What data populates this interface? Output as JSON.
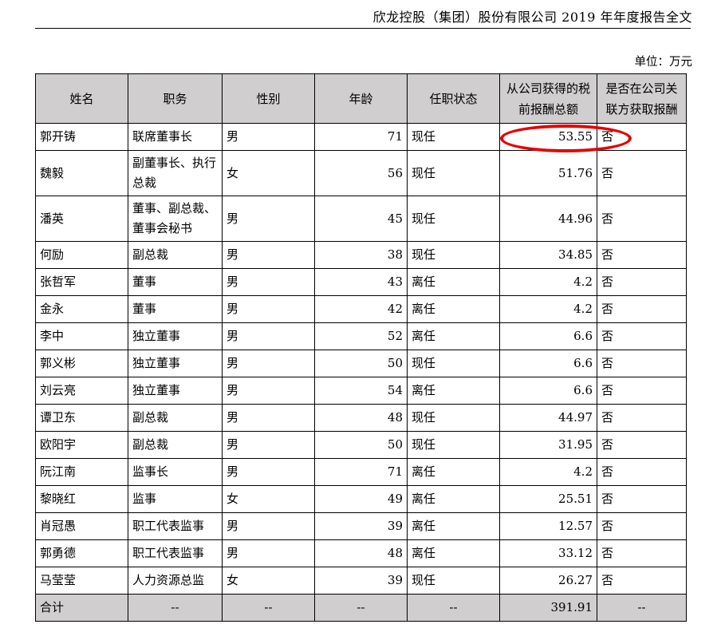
{
  "header": {
    "title": "欣龙控股（集团）股份有限公司 2019 年年度报告全文",
    "unit": "单位：万元"
  },
  "table": {
    "columns": [
      "姓名",
      "职务",
      "性别",
      "年龄",
      "任职状态",
      "从公司获得的税前报酬总额",
      "是否在公司关联方获取报酬"
    ],
    "rows": [
      {
        "name": "郭开铸",
        "title": "联席董事长",
        "gender": "男",
        "age": "71",
        "status": "现任",
        "pay": "53.55",
        "related": "否"
      },
      {
        "name": "魏毅",
        "title": "副董事长、执行总裁",
        "gender": "女",
        "age": "56",
        "status": "现任",
        "pay": "51.76",
        "related": "否"
      },
      {
        "name": "潘英",
        "title": "董事、副总裁、董事会秘书",
        "gender": "男",
        "age": "45",
        "status": "现任",
        "pay": "44.96",
        "related": "否"
      },
      {
        "name": "何励",
        "title": "副总裁",
        "gender": "男",
        "age": "38",
        "status": "现任",
        "pay": "34.85",
        "related": "否"
      },
      {
        "name": "张哲军",
        "title": "董事",
        "gender": "男",
        "age": "43",
        "status": "离任",
        "pay": "4.2",
        "related": "否"
      },
      {
        "name": "金永",
        "title": "董事",
        "gender": "男",
        "age": "42",
        "status": "离任",
        "pay": "4.2",
        "related": "否"
      },
      {
        "name": "李中",
        "title": "独立董事",
        "gender": "男",
        "age": "52",
        "status": "离任",
        "pay": "6.6",
        "related": "否"
      },
      {
        "name": "郭义彬",
        "title": "独立董事",
        "gender": "男",
        "age": "50",
        "status": "现任",
        "pay": "6.6",
        "related": "否"
      },
      {
        "name": "刘云亮",
        "title": "独立董事",
        "gender": "男",
        "age": "54",
        "status": "离任",
        "pay": "6.6",
        "related": "否"
      },
      {
        "name": "谭卫东",
        "title": "副总裁",
        "gender": "男",
        "age": "48",
        "status": "现任",
        "pay": "44.97",
        "related": "否"
      },
      {
        "name": "欧阳宇",
        "title": "副总裁",
        "gender": "男",
        "age": "50",
        "status": "现任",
        "pay": "31.95",
        "related": "否"
      },
      {
        "name": "阮江南",
        "title": "监事长",
        "gender": "男",
        "age": "71",
        "status": "离任",
        "pay": "4.2",
        "related": "否"
      },
      {
        "name": "黎晓红",
        "title": "监事",
        "gender": "女",
        "age": "49",
        "status": "离任",
        "pay": "25.51",
        "related": "否"
      },
      {
        "name": "肖冠愚",
        "title": "职工代表监事",
        "gender": "男",
        "age": "39",
        "status": "离任",
        "pay": "12.57",
        "related": "否"
      },
      {
        "name": "郭勇德",
        "title": "职工代表监事",
        "gender": "男",
        "age": "48",
        "status": "离任",
        "pay": "33.12",
        "related": "否"
      },
      {
        "name": "马莹莹",
        "title": "人力资源总监",
        "gender": "女",
        "age": "39",
        "status": "现任",
        "pay": "26.27",
        "related": "否"
      }
    ],
    "total": {
      "label": "合计",
      "title": "--",
      "gender": "--",
      "age": "--",
      "status": "--",
      "pay": "391.91",
      "related": "--"
    }
  },
  "highlight": {
    "color": "#e60000",
    "target": "53.55"
  }
}
